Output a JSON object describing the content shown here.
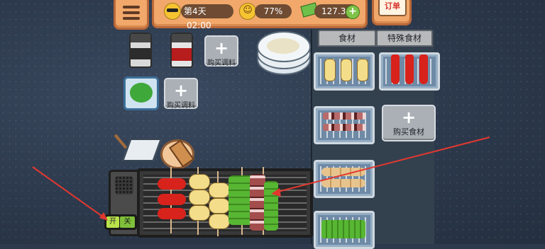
{
  "hud": {
    "day": "第4天",
    "time": "02:00",
    "satisfaction": "77%",
    "money": "127.3",
    "add_money_label": "+"
  },
  "order": {
    "label": "订单"
  },
  "tabs": [
    {
      "label": "食材"
    },
    {
      "label": "特殊食材"
    }
  ],
  "buttons": {
    "buy_seasoning_1": "购买调料",
    "buy_seasoning_2": "购买调料",
    "buy_ingredient": "购买食材",
    "plus": "+"
  },
  "switch": {
    "on": "开",
    "off": "关"
  },
  "ingredients": [
    {
      "name": "potato",
      "icon": "potato-skewers-icon"
    },
    {
      "name": "pepper",
      "icon": "pepper-skewers-icon"
    },
    {
      "name": "meat",
      "icon": "meat-skewers-icon"
    },
    {
      "name": "bun",
      "icon": "bun-skewers-icon"
    },
    {
      "name": "greens",
      "icon": "greens-skewers-icon"
    }
  ],
  "colors": {
    "accent_orange": "#f1a86a",
    "arrow_red": "#e2382f",
    "chili_red": "#d8221c",
    "potato_yellow": "#f3dd8a",
    "bean_green": "#57b632"
  }
}
